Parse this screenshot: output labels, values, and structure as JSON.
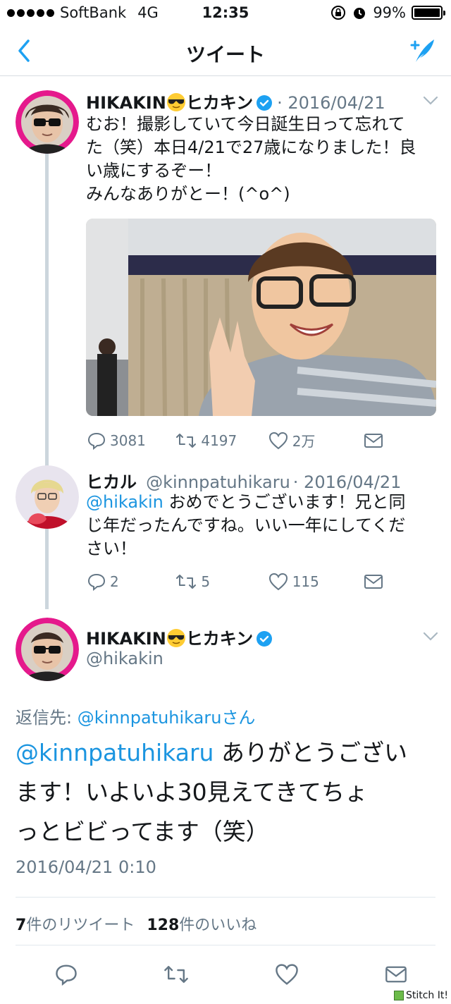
{
  "status_bar": {
    "carrier": "SoftBank",
    "network": "4G",
    "time": "12:35",
    "battery": "99%",
    "icons": [
      "rotation-lock-icon",
      "alarm-icon",
      "battery-icon"
    ]
  },
  "nav": {
    "title": "ツイート",
    "back_icon": "chevron-left-icon",
    "compose_icon": "compose-feather-icon"
  },
  "tweet1": {
    "name": "HIKAKIN",
    "name_suffix": "ヒカキン",
    "date": "· 2016/04/21",
    "text_lines": [
      "むお！撮影していて今日誕生日って忘れて",
      "た（笑）本日4/21で27歳になりました！良",
      "い歳にするぞー！",
      "みんなありがとー！(^o^)"
    ],
    "actions": {
      "replies": "3081",
      "retweets": "4197",
      "likes": "2万"
    }
  },
  "tweet2": {
    "name": "ヒカル",
    "handle": "@kinnpatuhikaru",
    "date": "· 2016/04/21",
    "mention": "@hikakin",
    "text_first": " おめでとうございます！兄と同",
    "text_lines": [
      "じ年だったんですね。いい一年にしてくだ",
      "さい！"
    ],
    "actions": {
      "replies": "2",
      "retweets": "5",
      "likes": "115"
    }
  },
  "main_tweet": {
    "name": "HIKAKIN",
    "name_suffix": "ヒカキン",
    "handle": "@hikakin",
    "reply_to_label": "返信先:",
    "reply_to_user": "@kinnpatuhikaru",
    "reply_to_suffix": "さん",
    "mention": "@kinnpatuhikaru",
    "text_first": " ありがとうござい",
    "text_lines": [
      "ます！いよいよ30見えてきてちょ",
      "っとビビってます（笑）"
    ],
    "timestamp": "2016/04/21 0:10",
    "retweet_count": "7",
    "retweet_label": "件のリツイート",
    "like_count": "128",
    "like_label": "件のいいね"
  },
  "watermark": "Stitch It!",
  "colors": {
    "accent": "#1da1f2",
    "link": "#1b95e0",
    "gray": "#657786",
    "avatar_ring": "#e5198c"
  }
}
